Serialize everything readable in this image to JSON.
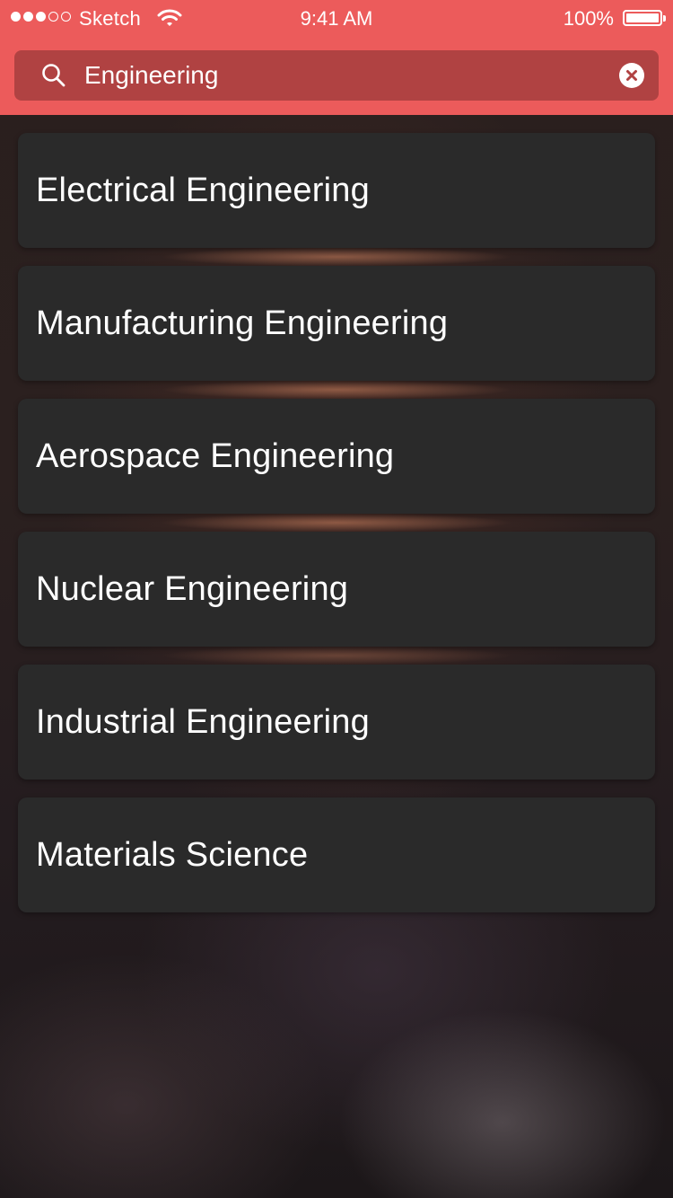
{
  "status_bar": {
    "carrier": "Sketch",
    "time": "9:41 AM",
    "battery": "100%",
    "signal_bars_filled": 3,
    "signal_bars_total": 5
  },
  "search": {
    "value": "Engineering",
    "icon": "search-icon",
    "clear_icon": "clear-icon"
  },
  "results": [
    {
      "label": "Electrical Engineering"
    },
    {
      "label": "Manufacturing Engineering"
    },
    {
      "label": "Aerospace Engineering"
    },
    {
      "label": "Nuclear Engineering"
    },
    {
      "label": "Industrial Engineering"
    },
    {
      "label": "Materials Science"
    }
  ],
  "colors": {
    "header": "#ec5b5b",
    "search_field": "#b04242",
    "card": "#2a2a2a",
    "text": "#ffffff"
  }
}
